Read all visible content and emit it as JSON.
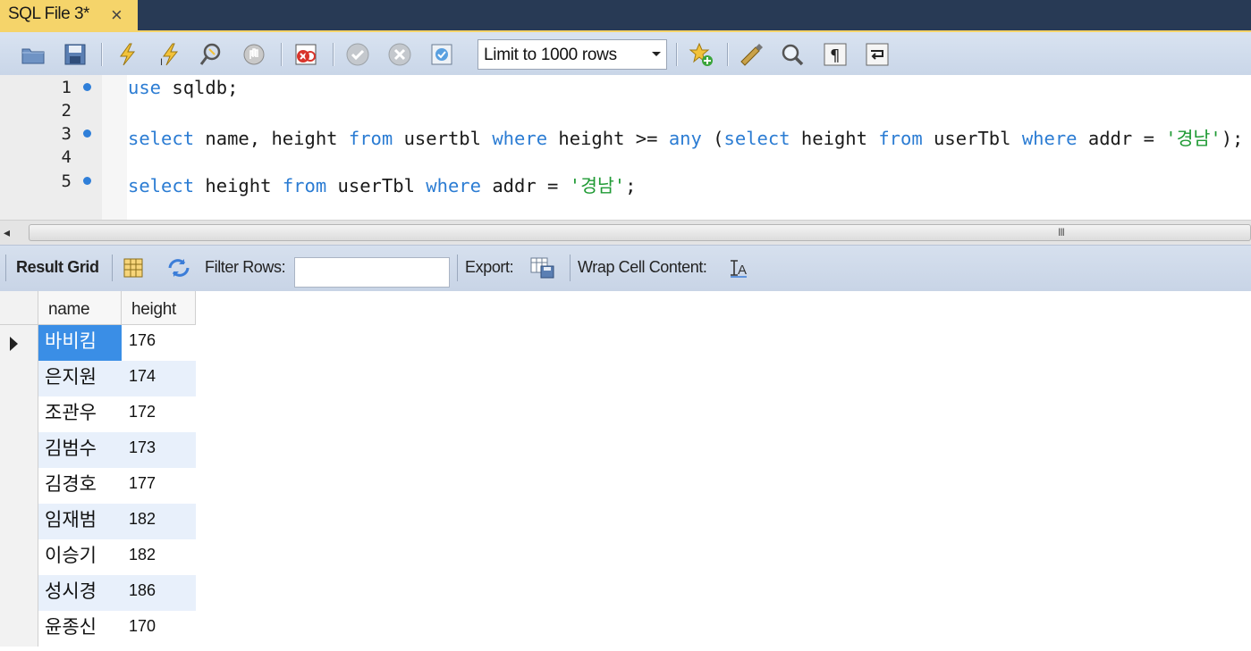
{
  "tab": {
    "label": "SQL File 3*",
    "close": "×"
  },
  "toolbar": {
    "limit_value": "Limit to 1000 rows",
    "icons": [
      "open-folder-icon",
      "save-icon",
      "execute-icon",
      "execute-current-icon",
      "explain-icon",
      "stop-icon",
      "toggle-error-icon",
      "commit-icon",
      "rollback-icon",
      "autocommit-icon",
      "bookmark-icon",
      "beautify-icon",
      "find-icon",
      "invisible-chars-icon",
      "wrap-lines-icon"
    ]
  },
  "editor": {
    "lines": [
      {
        "number": "1",
        "marker": true
      },
      {
        "number": "2",
        "marker": false
      },
      {
        "number": "3",
        "marker": true
      },
      {
        "number": "4",
        "marker": false
      },
      {
        "number": "5",
        "marker": true
      }
    ],
    "tokens": {
      "l1_use": "use",
      "l1_rest": " sqldb;",
      "l3_select": "select",
      "l3_a": " name, height ",
      "l3_from": "from",
      "l3_b": " usertbl ",
      "l3_where": "where",
      "l3_c": " height >= ",
      "l3_any": "any",
      "l3_d": " (",
      "l3_select2": "select",
      "l3_e": " height ",
      "l3_from2": "from",
      "l3_f": " userTbl ",
      "l3_where2": "where",
      "l3_g": " addr = ",
      "l3_str": "'경남'",
      "l3_h": ");",
      "l5_select": "select",
      "l5_a": " height ",
      "l5_from": "from",
      "l5_b": " userTbl ",
      "l5_where": "where",
      "l5_c": " addr = ",
      "l5_str": "'경남'",
      "l5_d": ";"
    },
    "keyword_color": "#2b7cd3",
    "string_color": "#1f9a34"
  },
  "scrollbar": {
    "grip": "III",
    "left_arrow": "◂"
  },
  "result_toolbar": {
    "result_grid": "Result Grid",
    "filter_rows": "Filter Rows:",
    "filter_value": "",
    "export": "Export:",
    "wrap": "Wrap Cell Content:"
  },
  "grid": {
    "columns": [
      "name",
      "height"
    ],
    "rows": [
      {
        "name": "바비킴",
        "height": "176"
      },
      {
        "name": "은지원",
        "height": "174"
      },
      {
        "name": "조관우",
        "height": "172"
      },
      {
        "name": "김범수",
        "height": "173"
      },
      {
        "name": "김경호",
        "height": "177"
      },
      {
        "name": "임재범",
        "height": "182"
      },
      {
        "name": "이승기",
        "height": "182"
      },
      {
        "name": "성시경",
        "height": "186"
      },
      {
        "name": "윤종신",
        "height": "170"
      }
    ],
    "selected_row": 0,
    "selection_color": "#3a8ee6"
  }
}
